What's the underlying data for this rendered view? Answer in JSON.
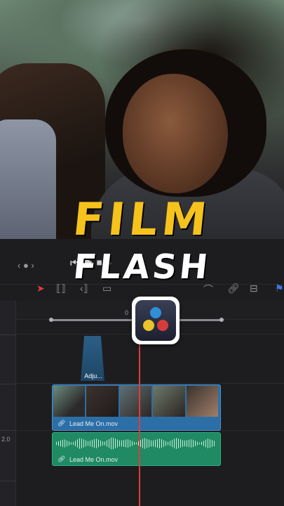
{
  "title": {
    "line1": "FILM",
    "line2": "FLASH"
  },
  "colors": {
    "title_yellow": "#f6c21c",
    "playhead": "#e03c3c",
    "video_clip": "#2c6fa6",
    "audio_clip": "#1f8a63"
  },
  "nav": {
    "glyph": "‹ ● ›"
  },
  "transport": {
    "glyph": "⏮ ▶ ⏹ ●"
  },
  "timeline": {
    "ruler_mark": "0",
    "track_value": "2.0",
    "adjustment_clip_label": "Adju...",
    "video_clip_label": "Lead Me On.mov",
    "audio_clip_label": "Lead Me On.mov"
  },
  "icons": [
    "pointer-icon",
    "trim-icon",
    "blade-icon",
    "link-icon",
    "lock-icon",
    "flag-icon",
    "davinci-resolve-logo"
  ]
}
